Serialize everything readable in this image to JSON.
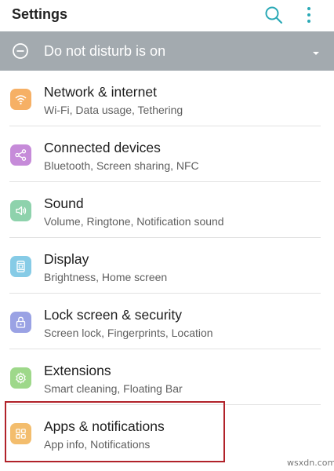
{
  "header": {
    "title": "Settings",
    "search_icon": "search-icon",
    "more_icon": "more-vertical-icon",
    "accent": "#2aa9b6"
  },
  "dnd_banner": {
    "label": "Do not disturb is on",
    "icon": "minus-circle-icon",
    "chevron": "chevron-down-icon",
    "background": "#a3aaaf"
  },
  "settings": {
    "items": [
      {
        "title": "Network & internet",
        "subtitle": "Wi-Fi, Data usage, Tethering",
        "icon": "wifi-icon",
        "color": "#f6b065"
      },
      {
        "title": "Connected devices",
        "subtitle": "Bluetooth, Screen sharing, NFC",
        "icon": "share-icon",
        "color": "#c68bd9"
      },
      {
        "title": "Sound",
        "subtitle": "Volume, Ringtone, Notification sound",
        "icon": "speaker-icon",
        "color": "#8ed2ac"
      },
      {
        "title": "Display",
        "subtitle": "Brightness, Home screen",
        "icon": "display-icon",
        "color": "#86cbe6"
      },
      {
        "title": "Lock screen & security",
        "subtitle": "Screen lock, Fingerprints, Location",
        "icon": "lock-icon",
        "color": "#9aa2e4"
      },
      {
        "title": "Extensions",
        "subtitle": "Smart cleaning, Floating Bar",
        "icon": "gear-icon",
        "color": "#9ed88a"
      },
      {
        "title": "Apps & notifications",
        "subtitle": "App info, Notifications",
        "icon": "apps-grid-icon",
        "color": "#f3bd6d"
      }
    ]
  },
  "highlight": {
    "color": "#b1222a"
  },
  "watermark": "wsxdn.com"
}
